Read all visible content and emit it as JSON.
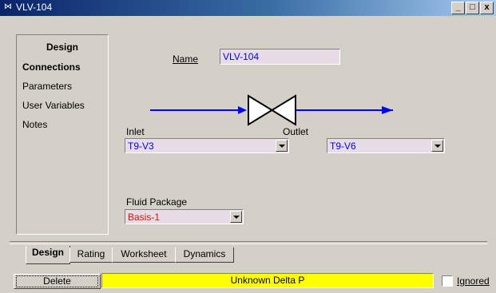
{
  "window": {
    "icon": "valve-icon",
    "title": "VLV-104",
    "minimize_label": "_",
    "maximize_label": "□",
    "close_label": "x"
  },
  "sidebar": {
    "heading": "Design",
    "items": [
      {
        "label": "Connections",
        "active": true
      },
      {
        "label": "Parameters",
        "active": false
      },
      {
        "label": "User Variables",
        "active": false
      },
      {
        "label": "Notes",
        "active": false
      }
    ]
  },
  "form": {
    "name_label": "Name",
    "name_value": "VLV-104",
    "inlet_label": "Inlet",
    "inlet_value": "T9-V3",
    "outlet_label": "Outlet",
    "outlet_value": "T9-V6",
    "fluid_package_label": "Fluid Package",
    "fluid_package_value": "Basis-1"
  },
  "colors": {
    "stream_blue": "#0000ff",
    "fluid_package_red": "#ff0000",
    "status_yellow": "#ffff00",
    "field_bg": "#e8dde6"
  },
  "tabs": [
    {
      "label": "Design",
      "active": true
    },
    {
      "label": "Rating",
      "active": false
    },
    {
      "label": "Worksheet",
      "active": false
    },
    {
      "label": "Dynamics",
      "active": false
    }
  ],
  "bottom": {
    "delete_label": "Delete",
    "status_text": "Unknown Delta P",
    "ignored_label": "Ignored",
    "ignored_checked": false
  }
}
